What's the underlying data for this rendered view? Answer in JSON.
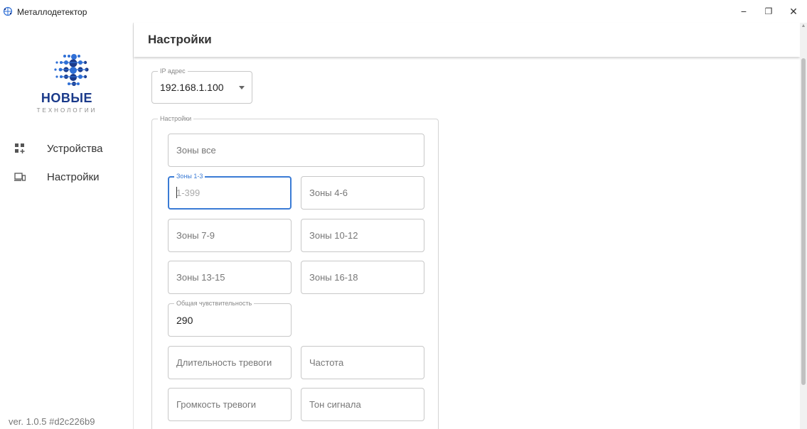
{
  "window": {
    "title": "Металлодетектор",
    "controls": {
      "minimize": "−",
      "maximize": "❐",
      "close": "✕"
    },
    "app_icon": "network-globe-icon"
  },
  "sidebar": {
    "logo": {
      "main": "НОВЫЕ",
      "sub": "ТЕХНОЛОГИИ",
      "colors": {
        "primary": "#1a3a8a",
        "accent": "#2f6fd6"
      }
    },
    "items": [
      {
        "label": "Устройства",
        "icon": "grid-add-icon"
      },
      {
        "label": "Настройки",
        "icon": "devices-icon"
      }
    ],
    "version": "ver. 1.0.5 #d2c226b9"
  },
  "header": {
    "title": "Настройки"
  },
  "ip": {
    "label": "IP адрес",
    "value": "192.168.1.100"
  },
  "settings": {
    "label": "Настройки",
    "zones_all": {
      "placeholder": "Зоны все"
    },
    "zones_1_3": {
      "label": "Зоны 1-3",
      "placeholder": "1-399"
    },
    "zones_4_6": {
      "placeholder": "Зоны 4-6"
    },
    "zones_7_9": {
      "placeholder": "Зоны 7-9"
    },
    "zones_10_12": {
      "placeholder": "Зоны 10-12"
    },
    "zones_13_15": {
      "placeholder": "Зоны 13-15"
    },
    "zones_16_18": {
      "placeholder": "Зоны 16-18"
    },
    "sensitivity": {
      "label": "Общая чувствительность",
      "value": "290"
    },
    "alarm_duration": {
      "placeholder": "Длительность тревоги"
    },
    "frequency": {
      "placeholder": "Частота"
    },
    "alarm_volume": {
      "placeholder": "Громкость тревоги"
    },
    "signal_tone": {
      "placeholder": "Тон сигнала"
    }
  },
  "colors": {
    "focus": "#3a7bd5",
    "border": "#c8c8c8"
  }
}
